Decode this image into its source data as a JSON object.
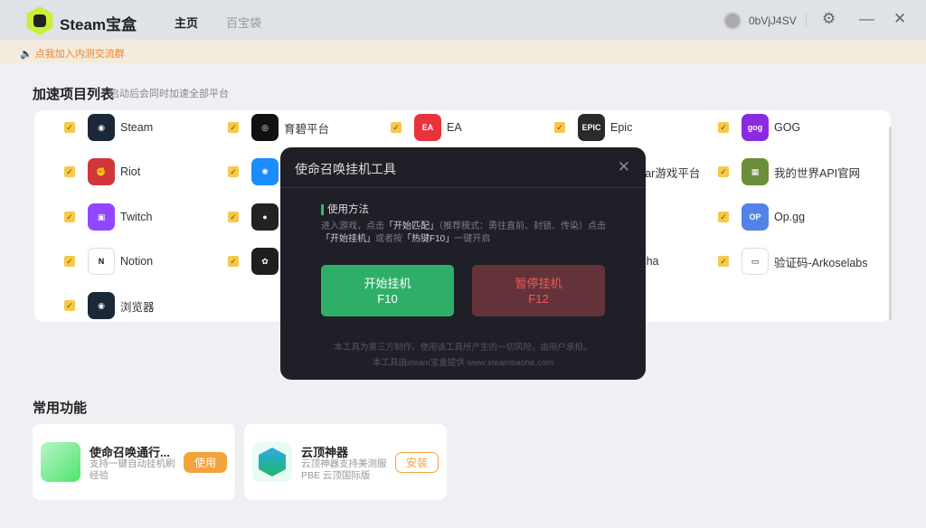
{
  "app": {
    "name": "Steam宝盒",
    "nav": [
      {
        "label": "主页",
        "active": true
      },
      {
        "label": "百宝袋",
        "active": false
      }
    ],
    "username": "0bVjJ4SV",
    "icons": [
      "settings-icon",
      "minimize-icon",
      "close-icon"
    ]
  },
  "notice": "点我加入内测交流群",
  "accel": {
    "title": "加速项目列表",
    "subtitle": "启动后会同时加速全部平台",
    "items": [
      {
        "label": "Steam",
        "icon": "steam-icon",
        "color": "#1b2838",
        "glyph": "◉"
      },
      {
        "label": "育碧平台",
        "icon": "ubisoft-icon",
        "color": "#111111",
        "glyph": "◎"
      },
      {
        "label": "EA",
        "icon": "ea-icon",
        "color": "#e8323c",
        "glyph": "EA"
      },
      {
        "label": "Epic",
        "icon": "epic-icon",
        "color": "#2a2a2a",
        "glyph": "EPIC"
      },
      {
        "label": "GOG",
        "icon": "gog-icon",
        "color": "#8a2be2",
        "glyph": "gog"
      },
      {
        "label": "Riot",
        "icon": "riot-icon",
        "color": "#d13639",
        "glyph": "✊"
      },
      {
        "label": "",
        "icon": "battlenet-icon",
        "color": "#1a8cff",
        "glyph": "✺"
      },
      {
        "label": "",
        "icon": "platform-icon",
        "color": "#888888",
        "glyph": ""
      },
      {
        "label": "Rockstar游戏平台",
        "icon": "platform-icon",
        "color": "#888888",
        "glyph": ""
      },
      {
        "label": "我的世界API官网",
        "icon": "minecraft-icon",
        "color": "#6b8e3a",
        "glyph": "▦"
      },
      {
        "label": "Twitch",
        "icon": "twitch-icon",
        "color": "#9146ff",
        "glyph": "▣"
      },
      {
        "label": "",
        "icon": "github-icon",
        "color": "#222222",
        "glyph": "●"
      },
      {
        "label": "",
        "icon": "platform-icon",
        "color": "#888888",
        "glyph": ""
      },
      {
        "label": "",
        "icon": "platform-icon",
        "color": "#888888",
        "glyph": ""
      },
      {
        "label": "Op.gg",
        "icon": "opgg-icon",
        "color": "#5383e8",
        "glyph": "OP"
      },
      {
        "label": "Notion",
        "icon": "notion-icon",
        "color": "#ffffff",
        "glyph": "N"
      },
      {
        "label": "",
        "icon": "figma-icon",
        "color": "#1e1e1e",
        "glyph": "✿"
      },
      {
        "label": "",
        "icon": "platform-icon",
        "color": "#888888",
        "glyph": ""
      },
      {
        "label": "hCaptcha",
        "icon": "hcaptcha-icon",
        "color": "#888888",
        "glyph": ""
      },
      {
        "label": "验证码-Arkoselabs",
        "icon": "captcha-icon",
        "color": "#ffffff",
        "glyph": "▭"
      },
      {
        "label": "浏览器",
        "icon": "browser-steam-icon",
        "color": "#1b2838",
        "glyph": "◉"
      }
    ]
  },
  "common": {
    "title": "常用功能",
    "cards": [
      {
        "title": "使命召唤通行...",
        "desc": "支持一键自动挂机刷经验",
        "button": "使用"
      },
      {
        "title": "云顶神器",
        "desc": "云顶神器支持美测服PBE 云顶国际版",
        "button": "安装"
      }
    ]
  },
  "modal": {
    "title": "使命召唤挂机工具",
    "howto_title": "使用方法",
    "desc": [
      "进入游戏，点击",
      "「开始匹配」",
      "（推荐模式：勇往直前、封锁、传染）点击",
      "「开始挂机」",
      "或者按",
      "「热键F10」",
      "一键开启"
    ],
    "start": {
      "label": "开始挂机",
      "key": "F10"
    },
    "pause": {
      "label": "暂停挂机",
      "key": "F12"
    },
    "footer1": "本工具为第三方制作，使用该工具所产生的一切风险，由用户承担。",
    "footer2": "本工具由steam宝盒提供 www.steambaohe.com"
  }
}
